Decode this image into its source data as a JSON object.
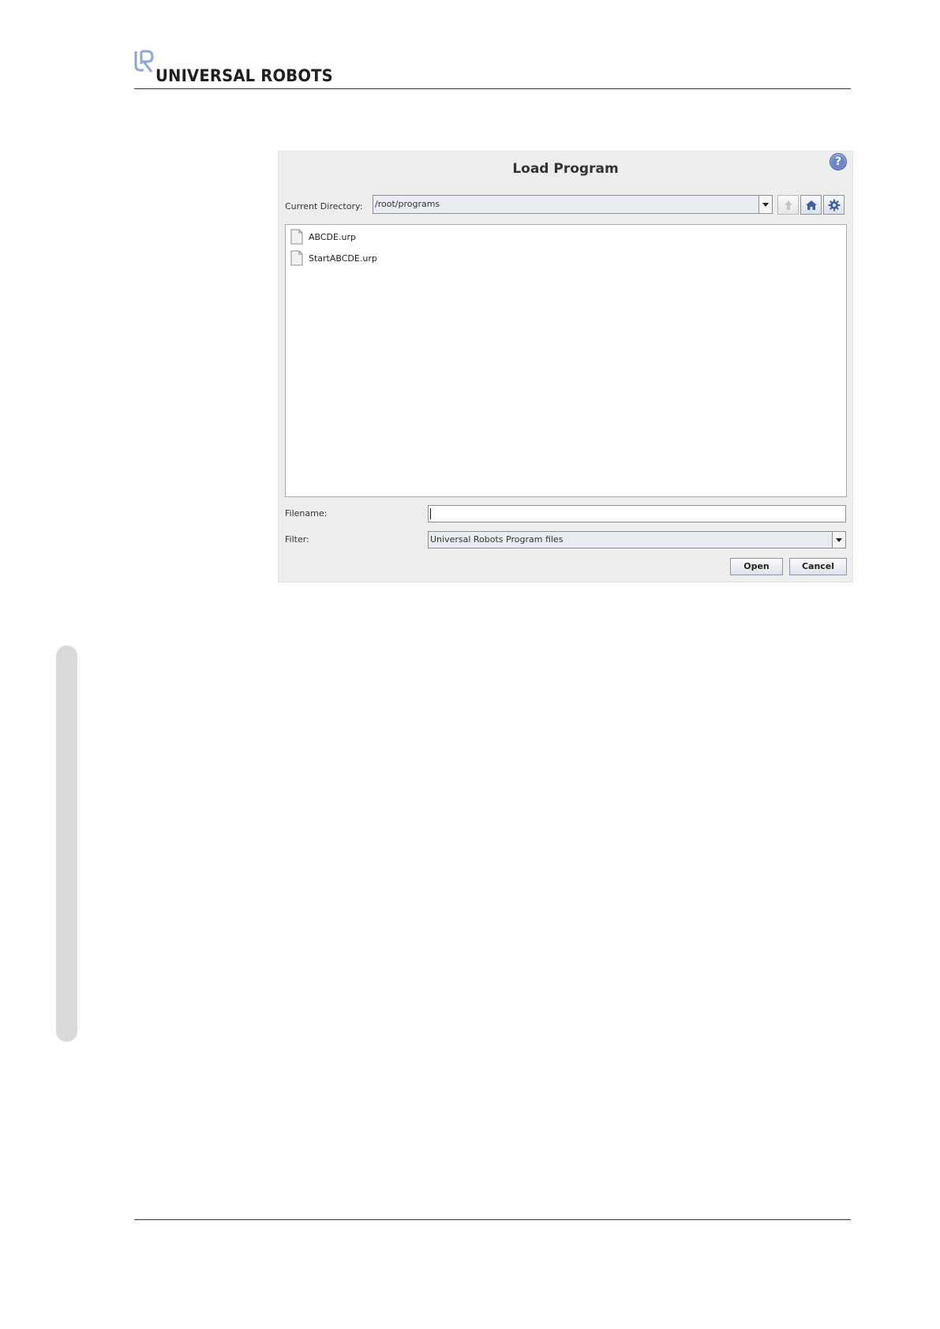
{
  "header": {
    "brand_name": "UNIVERSAL ROBOTS",
    "logo_icon": "universal-robots-logo-icon"
  },
  "dialog": {
    "title": "Load Program",
    "help_icon": "help-icon",
    "help_symbol": "?",
    "current_directory_label": "Current Directory:",
    "current_directory_value": "/root/programs",
    "toolbar": {
      "up_icon": "up-folder-icon",
      "home_icon": "home-icon",
      "prefs_icon": "gear-icon"
    },
    "files": [
      {
        "name": "ABCDE.urp",
        "icon": "file-icon"
      },
      {
        "name": "StartABCDE.urp",
        "icon": "file-icon"
      }
    ],
    "filename_label": "Filename:",
    "filename_value": "",
    "filter_label": "Filter:",
    "filter_value": "Universal Robots Program files",
    "open_label": "Open",
    "cancel_label": "Cancel"
  }
}
